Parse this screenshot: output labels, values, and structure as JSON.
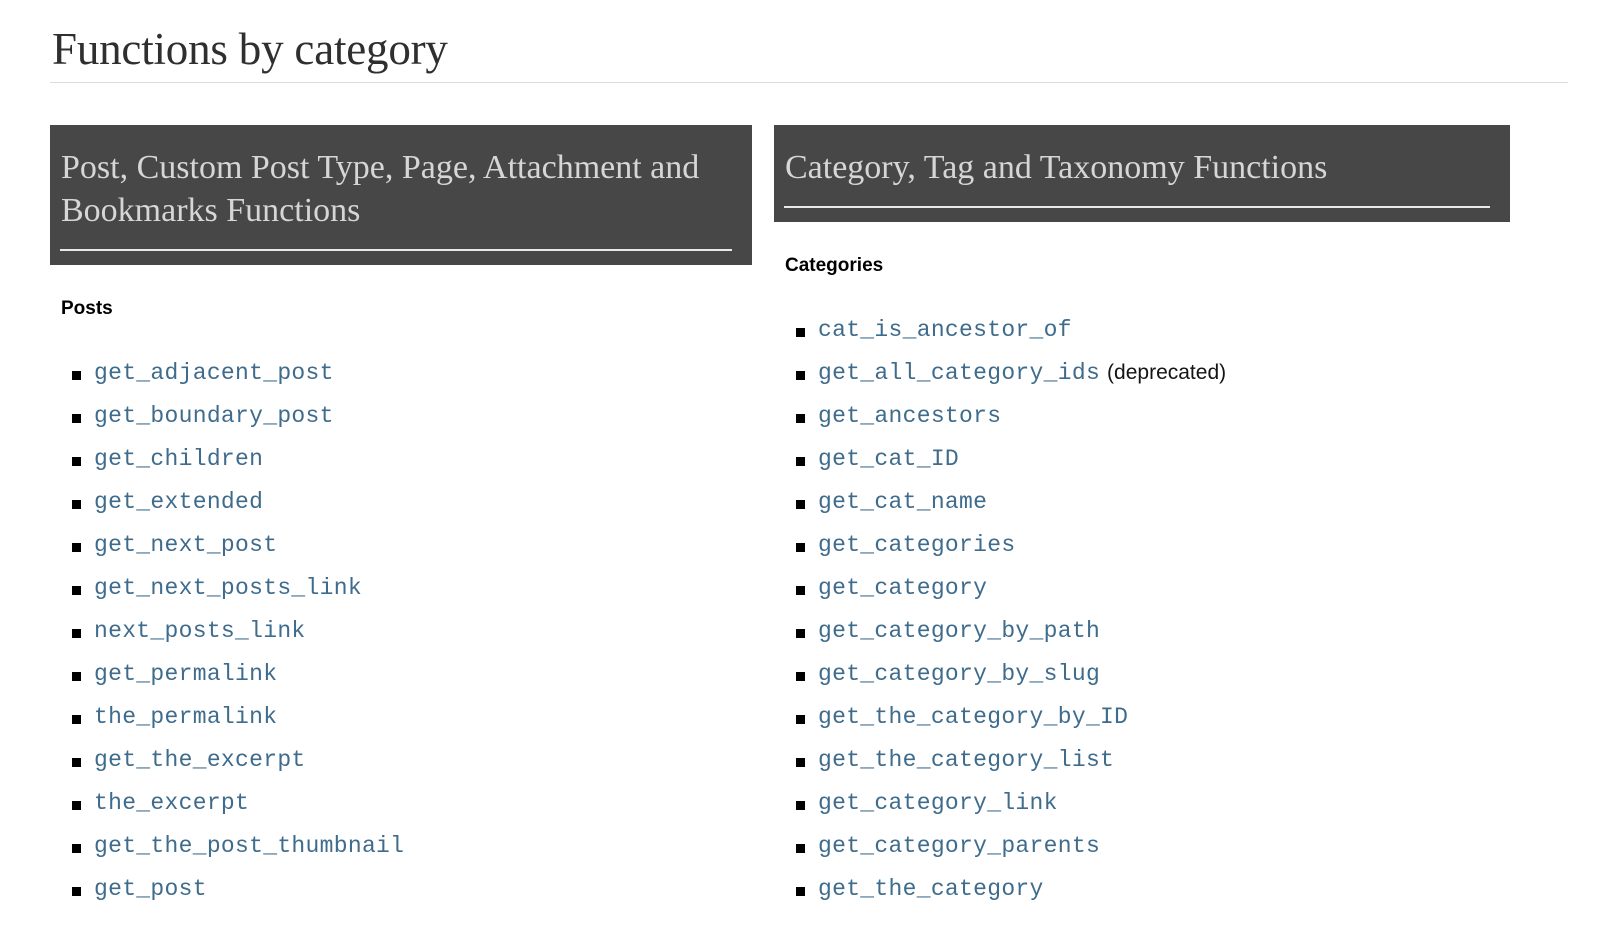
{
  "page": {
    "title": "Functions by category"
  },
  "sections": [
    {
      "id": "post-functions",
      "heading": "Post, Custom Post Type, Page, Attachment and Bookmarks Functions",
      "sub_heading": "Posts",
      "items": [
        {
          "name": "get_adjacent_post",
          "note": ""
        },
        {
          "name": "get_boundary_post",
          "note": ""
        },
        {
          "name": "get_children",
          "note": ""
        },
        {
          "name": "get_extended",
          "note": ""
        },
        {
          "name": "get_next_post",
          "note": ""
        },
        {
          "name": "get_next_posts_link",
          "note": ""
        },
        {
          "name": "next_posts_link",
          "note": ""
        },
        {
          "name": "get_permalink",
          "note": ""
        },
        {
          "name": "the_permalink",
          "note": ""
        },
        {
          "name": "get_the_excerpt",
          "note": ""
        },
        {
          "name": "the_excerpt",
          "note": ""
        },
        {
          "name": "get_the_post_thumbnail",
          "note": ""
        },
        {
          "name": "get_post",
          "note": ""
        }
      ]
    },
    {
      "id": "taxonomy-functions",
      "heading": "Category, Tag and Taxonomy Functions",
      "sub_heading": "Categories",
      "items": [
        {
          "name": "cat_is_ancestor_of",
          "note": ""
        },
        {
          "name": "get_all_category_ids",
          "note": "(deprecated)"
        },
        {
          "name": "get_ancestors",
          "note": ""
        },
        {
          "name": "get_cat_ID",
          "note": ""
        },
        {
          "name": "get_cat_name",
          "note": ""
        },
        {
          "name": "get_categories",
          "note": ""
        },
        {
          "name": "get_category",
          "note": ""
        },
        {
          "name": "get_category_by_path",
          "note": ""
        },
        {
          "name": "get_category_by_slug",
          "note": ""
        },
        {
          "name": "get_the_category_by_ID",
          "note": ""
        },
        {
          "name": "get_the_category_list",
          "note": ""
        },
        {
          "name": "get_category_link",
          "note": ""
        },
        {
          "name": "get_category_parents",
          "note": ""
        },
        {
          "name": "get_the_category",
          "note": ""
        }
      ]
    }
  ],
  "colors": {
    "header_background": "#474747",
    "header_text": "#d6d6d6",
    "link": "#3f6c8c",
    "page_title": "#2f2f2f",
    "rule": "#dcdcdc"
  }
}
